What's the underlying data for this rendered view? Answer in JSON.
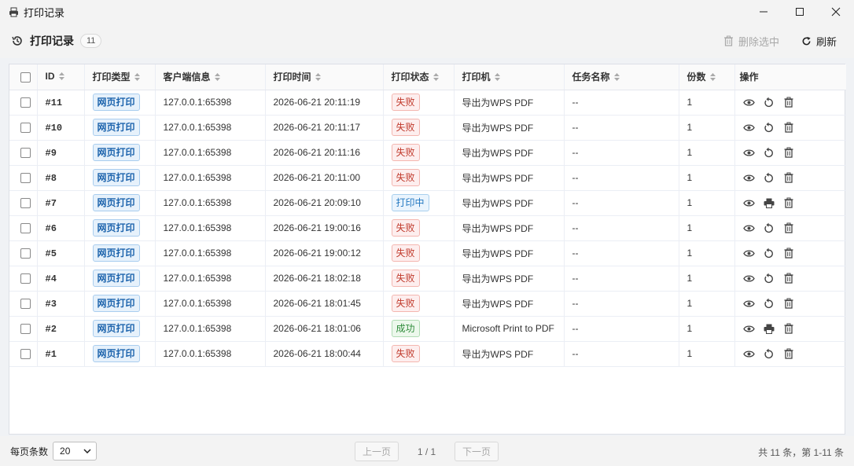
{
  "window": {
    "title": "打印记录",
    "app_icon": "printer-app-icon"
  },
  "header": {
    "title": "打印记录",
    "count": "11",
    "delete_selected_label": "删除选中",
    "refresh_label": "刷新"
  },
  "table": {
    "columns": [
      "ID",
      "打印类型",
      "客户端信息",
      "打印时间",
      "打印状态",
      "打印机",
      "任务名称",
      "份数",
      "操作"
    ],
    "rows": [
      {
        "id": "#11",
        "type": "网页打印",
        "client": "127.0.0.1:65398",
        "time": "2026-06-21 20:11:19",
        "status": "失败",
        "status_kind": "fail",
        "printer": "导出为WPS PDF",
        "task": "--",
        "copies": "1",
        "second_action": "retry"
      },
      {
        "id": "#10",
        "type": "网页打印",
        "client": "127.0.0.1:65398",
        "time": "2026-06-21 20:11:17",
        "status": "失败",
        "status_kind": "fail",
        "printer": "导出为WPS PDF",
        "task": "--",
        "copies": "1",
        "second_action": "retry"
      },
      {
        "id": "#9",
        "type": "网页打印",
        "client": "127.0.0.1:65398",
        "time": "2026-06-21 20:11:16",
        "status": "失败",
        "status_kind": "fail",
        "printer": "导出为WPS PDF",
        "task": "--",
        "copies": "1",
        "second_action": "retry"
      },
      {
        "id": "#8",
        "type": "网页打印",
        "client": "127.0.0.1:65398",
        "time": "2026-06-21 20:11:00",
        "status": "失败",
        "status_kind": "fail",
        "printer": "导出为WPS PDF",
        "task": "--",
        "copies": "1",
        "second_action": "retry"
      },
      {
        "id": "#7",
        "type": "网页打印",
        "client": "127.0.0.1:65398",
        "time": "2026-06-21 20:09:10",
        "status": "打印中",
        "status_kind": "printing",
        "printer": "导出为WPS PDF",
        "task": "--",
        "copies": "1",
        "second_action": "print"
      },
      {
        "id": "#6",
        "type": "网页打印",
        "client": "127.0.0.1:65398",
        "time": "2026-06-21 19:00:16",
        "status": "失败",
        "status_kind": "fail",
        "printer": "导出为WPS PDF",
        "task": "--",
        "copies": "1",
        "second_action": "retry"
      },
      {
        "id": "#5",
        "type": "网页打印",
        "client": "127.0.0.1:65398",
        "time": "2026-06-21 19:00:12",
        "status": "失败",
        "status_kind": "fail",
        "printer": "导出为WPS PDF",
        "task": "--",
        "copies": "1",
        "second_action": "retry"
      },
      {
        "id": "#4",
        "type": "网页打印",
        "client": "127.0.0.1:65398",
        "time": "2026-06-21 18:02:18",
        "status": "失败",
        "status_kind": "fail",
        "printer": "导出为WPS PDF",
        "task": "--",
        "copies": "1",
        "second_action": "retry"
      },
      {
        "id": "#3",
        "type": "网页打印",
        "client": "127.0.0.1:65398",
        "time": "2026-06-21 18:01:45",
        "status": "失败",
        "status_kind": "fail",
        "printer": "导出为WPS PDF",
        "task": "--",
        "copies": "1",
        "second_action": "retry"
      },
      {
        "id": "#2",
        "type": "网页打印",
        "client": "127.0.0.1:65398",
        "time": "2026-06-21 18:01:06",
        "status": "成功",
        "status_kind": "success",
        "printer": "Microsoft Print to PDF",
        "task": "--",
        "copies": "1",
        "second_action": "print"
      },
      {
        "id": "#1",
        "type": "网页打印",
        "client": "127.0.0.1:65398",
        "time": "2026-06-21 18:00:44",
        "status": "失败",
        "status_kind": "fail",
        "printer": "导出为WPS PDF",
        "task": "--",
        "copies": "1",
        "second_action": "retry"
      }
    ]
  },
  "footer": {
    "page_size_label": "每页条数",
    "page_size_value": "20",
    "prev_label": "上一页",
    "page_info": "1 / 1",
    "next_label": "下一页",
    "total_text": "共 11 条，第 1-11 条"
  },
  "colors": {
    "accent": "#1d64ad",
    "fail": "#c0392b",
    "printing": "#2277c0",
    "success": "#2e8b3a"
  }
}
